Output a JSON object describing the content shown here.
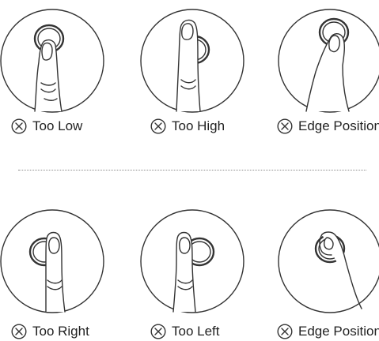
{
  "row1": [
    {
      "label": "Too Low",
      "icon": "x-circle-icon"
    },
    {
      "label": "Too High",
      "icon": "x-circle-icon"
    },
    {
      "label": "Edge Position",
      "icon": "x-circle-icon"
    }
  ],
  "row2": [
    {
      "label": "Too Right",
      "icon": "x-circle-icon"
    },
    {
      "label": "Too Left",
      "icon": "x-circle-icon"
    },
    {
      "label": "Edge Position",
      "icon": "x-circle-icon"
    }
  ],
  "colors": {
    "stroke": "#333333",
    "text": "#222222",
    "divider": "#8a8a8a"
  }
}
